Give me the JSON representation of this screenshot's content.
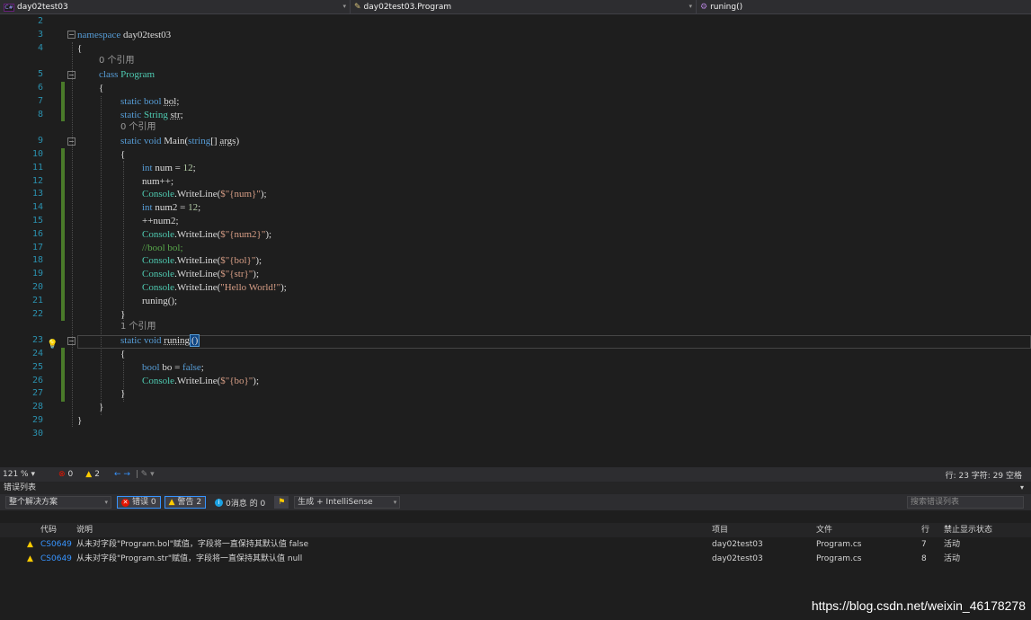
{
  "navbar": {
    "project": "day02test03",
    "class": "day02test03.Program",
    "member": "runing()",
    "project_icon": "C#"
  },
  "line_numbers": [
    "2",
    "3",
    "4",
    "5",
    "6",
    "7",
    "8",
    "9",
    "10",
    "11",
    "12",
    "13",
    "14",
    "15",
    "16",
    "17",
    "18",
    "19",
    "20",
    "21",
    "22",
    "23",
    "24",
    "25",
    "26",
    "27",
    "28",
    "29",
    "30"
  ],
  "code": {
    "l3_kw": "namespace",
    "l3_name": " day02test03",
    "l4": "{",
    "lens1": "0 个引用",
    "l5_kw": "class",
    "l5_name": " Program",
    "l6": "{",
    "l7_kw": "static bool",
    "l7_var": "bol",
    "l7_end": ";",
    "l8_kw": "static",
    "l8_ty": "String",
    "l8_var": "str",
    "l8_end": ";",
    "lens2": "0 个引用",
    "l9_kw": "static void",
    "l9_main": " Main(",
    "l9_ty": "string",
    "l9_args": "[] ",
    "l9_argsname": "args",
    "l9_end": ")",
    "l10": "{",
    "l11_kw": "int",
    "l11_rest": " num = ",
    "l11_num": "12",
    "l11_end": ";",
    "l12": "num++;",
    "l13_ty": "Console",
    "l13_a": ".WriteLine(",
    "l13_str": "$\"{num}\"",
    "l13_end": ");",
    "l14_kw": "int",
    "l14_rest": " num2 = ",
    "l14_num": "12",
    "l14_end": ";",
    "l15": "++num2;",
    "l16_ty": "Console",
    "l16_a": ".WriteLine(",
    "l16_str": "$\"{num2}\"",
    "l16_end": ");",
    "l17": "//bool bol;",
    "l18_ty": "Console",
    "l18_a": ".WriteLine(",
    "l18_str": "$\"{bol}\"",
    "l18_end": ");",
    "l19_ty": "Console",
    "l19_a": ".WriteLine(",
    "l19_str": "$\"{str}\"",
    "l19_end": ");",
    "l20_ty": "Console",
    "l20_a": ".WriteLine(",
    "l20_str": "\"Hello World!\"",
    "l20_end": ");",
    "l21": "runing();",
    "l22": "}",
    "lens3": "1 个引用",
    "l23_kw": "static void",
    "l23_name": "runing",
    "l23_paren": "()",
    "l24": "{",
    "l25_kw": "bool",
    "l25_rest": " bo = ",
    "l25_false": "false",
    "l25_end": ";",
    "l26_ty": "Console",
    "l26_a": ".WriteLine(",
    "l26_str": "$\"{bo}\"",
    "l26_end": ");",
    "l27": "}",
    "l28": "}",
    "l29": "}"
  },
  "editor_status": {
    "zoom": "121 %",
    "errors": "0",
    "warnings": "2",
    "nav": "← →",
    "position": "行: 23   字符: 29   空格"
  },
  "error_list": {
    "title": "错误列表",
    "scope": "整个解决方案",
    "errors_btn": "错误 0",
    "warnings_btn": "警告 2",
    "messages_btn": "0消息 的 0",
    "build_filter": "生成 + IntelliSense",
    "search_placeholder": "搜索错误列表",
    "columns": {
      "code": "代码",
      "desc": "说明",
      "project": "项目",
      "file": "文件",
      "line": "行",
      "suppress": "禁止显示状态"
    },
    "rows": [
      {
        "code": "CS0649",
        "desc": "从未对字段\"Program.bol\"赋值，字段将一直保持其默认值 false",
        "project": "day02test03",
        "file": "Program.cs",
        "line": "7",
        "suppress": "活动"
      },
      {
        "code": "CS0649",
        "desc": "从未对字段\"Program.str\"赋值，字段将一直保持其默认值 null",
        "project": "day02test03",
        "file": "Program.cs",
        "line": "8",
        "suppress": "活动"
      }
    ]
  },
  "watermark": "https://blog.csdn.net/weixin_46178278"
}
